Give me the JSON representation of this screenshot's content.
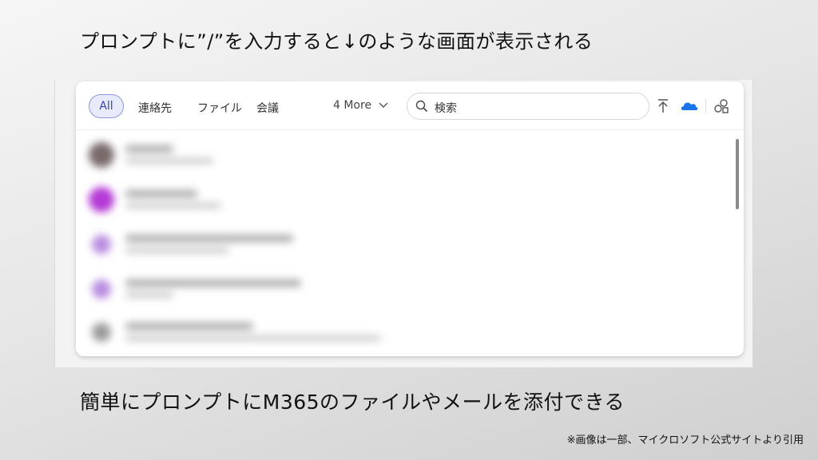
{
  "slide": {
    "headline": "プロンプトに”/”を入力すると↓のような画面が表示される",
    "subline": "簡単にプロンプトにM365のファイルやメールを添付できる",
    "credit": "※画像は一部、マイクロソフト公式サイトより引用"
  },
  "picker": {
    "filters": {
      "all": "All",
      "contacts": "連絡先",
      "files": "ファイル",
      "meetings": "会議",
      "more": "4 More"
    },
    "search": {
      "placeholder": "検索"
    },
    "icons": [
      "upload-icon",
      "onedrive-cloud-icon",
      "link-sharing-icon"
    ],
    "accent_color": "#3a44a8",
    "onedrive_color": "#1a73e8",
    "results": [
      {
        "avatar_color": "#7a6a6a",
        "blurred": true
      },
      {
        "avatar_color": "#b53ad6",
        "blurred": true
      },
      {
        "avatar_color": "#b98de0",
        "blurred": true
      },
      {
        "avatar_color": "#b98de0",
        "blurred": true
      },
      {
        "avatar_color": "#9b9b9b",
        "blurred": true
      }
    ]
  }
}
